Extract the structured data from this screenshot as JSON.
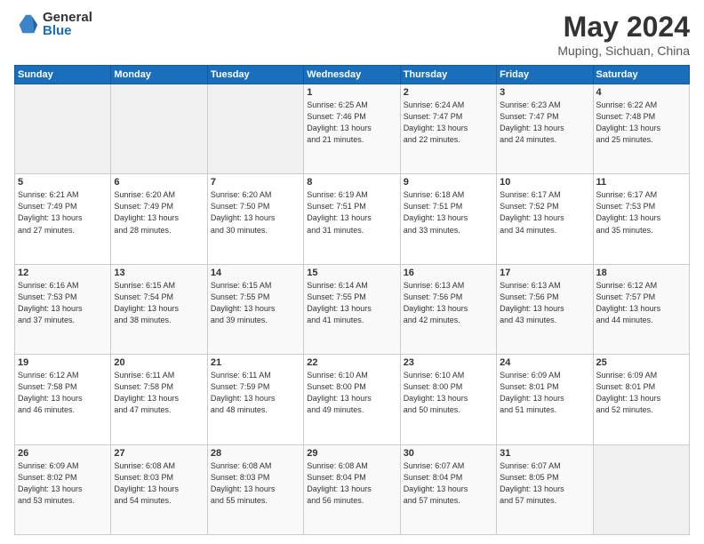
{
  "header": {
    "logo_general": "General",
    "logo_blue": "Blue",
    "title": "May 2024",
    "subtitle": "Muping, Sichuan, China"
  },
  "days_of_week": [
    "Sunday",
    "Monday",
    "Tuesday",
    "Wednesday",
    "Thursday",
    "Friday",
    "Saturday"
  ],
  "weeks": [
    {
      "days": [
        {
          "num": "",
          "info": ""
        },
        {
          "num": "",
          "info": ""
        },
        {
          "num": "",
          "info": ""
        },
        {
          "num": "1",
          "info": "Sunrise: 6:25 AM\nSunset: 7:46 PM\nDaylight: 13 hours\nand 21 minutes."
        },
        {
          "num": "2",
          "info": "Sunrise: 6:24 AM\nSunset: 7:47 PM\nDaylight: 13 hours\nand 22 minutes."
        },
        {
          "num": "3",
          "info": "Sunrise: 6:23 AM\nSunset: 7:47 PM\nDaylight: 13 hours\nand 24 minutes."
        },
        {
          "num": "4",
          "info": "Sunrise: 6:22 AM\nSunset: 7:48 PM\nDaylight: 13 hours\nand 25 minutes."
        }
      ]
    },
    {
      "days": [
        {
          "num": "5",
          "info": "Sunrise: 6:21 AM\nSunset: 7:49 PM\nDaylight: 13 hours\nand 27 minutes."
        },
        {
          "num": "6",
          "info": "Sunrise: 6:20 AM\nSunset: 7:49 PM\nDaylight: 13 hours\nand 28 minutes."
        },
        {
          "num": "7",
          "info": "Sunrise: 6:20 AM\nSunset: 7:50 PM\nDaylight: 13 hours\nand 30 minutes."
        },
        {
          "num": "8",
          "info": "Sunrise: 6:19 AM\nSunset: 7:51 PM\nDaylight: 13 hours\nand 31 minutes."
        },
        {
          "num": "9",
          "info": "Sunrise: 6:18 AM\nSunset: 7:51 PM\nDaylight: 13 hours\nand 33 minutes."
        },
        {
          "num": "10",
          "info": "Sunrise: 6:17 AM\nSunset: 7:52 PM\nDaylight: 13 hours\nand 34 minutes."
        },
        {
          "num": "11",
          "info": "Sunrise: 6:17 AM\nSunset: 7:53 PM\nDaylight: 13 hours\nand 35 minutes."
        }
      ]
    },
    {
      "days": [
        {
          "num": "12",
          "info": "Sunrise: 6:16 AM\nSunset: 7:53 PM\nDaylight: 13 hours\nand 37 minutes."
        },
        {
          "num": "13",
          "info": "Sunrise: 6:15 AM\nSunset: 7:54 PM\nDaylight: 13 hours\nand 38 minutes."
        },
        {
          "num": "14",
          "info": "Sunrise: 6:15 AM\nSunset: 7:55 PM\nDaylight: 13 hours\nand 39 minutes."
        },
        {
          "num": "15",
          "info": "Sunrise: 6:14 AM\nSunset: 7:55 PM\nDaylight: 13 hours\nand 41 minutes."
        },
        {
          "num": "16",
          "info": "Sunrise: 6:13 AM\nSunset: 7:56 PM\nDaylight: 13 hours\nand 42 minutes."
        },
        {
          "num": "17",
          "info": "Sunrise: 6:13 AM\nSunset: 7:56 PM\nDaylight: 13 hours\nand 43 minutes."
        },
        {
          "num": "18",
          "info": "Sunrise: 6:12 AM\nSunset: 7:57 PM\nDaylight: 13 hours\nand 44 minutes."
        }
      ]
    },
    {
      "days": [
        {
          "num": "19",
          "info": "Sunrise: 6:12 AM\nSunset: 7:58 PM\nDaylight: 13 hours\nand 46 minutes."
        },
        {
          "num": "20",
          "info": "Sunrise: 6:11 AM\nSunset: 7:58 PM\nDaylight: 13 hours\nand 47 minutes."
        },
        {
          "num": "21",
          "info": "Sunrise: 6:11 AM\nSunset: 7:59 PM\nDaylight: 13 hours\nand 48 minutes."
        },
        {
          "num": "22",
          "info": "Sunrise: 6:10 AM\nSunset: 8:00 PM\nDaylight: 13 hours\nand 49 minutes."
        },
        {
          "num": "23",
          "info": "Sunrise: 6:10 AM\nSunset: 8:00 PM\nDaylight: 13 hours\nand 50 minutes."
        },
        {
          "num": "24",
          "info": "Sunrise: 6:09 AM\nSunset: 8:01 PM\nDaylight: 13 hours\nand 51 minutes."
        },
        {
          "num": "25",
          "info": "Sunrise: 6:09 AM\nSunset: 8:01 PM\nDaylight: 13 hours\nand 52 minutes."
        }
      ]
    },
    {
      "days": [
        {
          "num": "26",
          "info": "Sunrise: 6:09 AM\nSunset: 8:02 PM\nDaylight: 13 hours\nand 53 minutes."
        },
        {
          "num": "27",
          "info": "Sunrise: 6:08 AM\nSunset: 8:03 PM\nDaylight: 13 hours\nand 54 minutes."
        },
        {
          "num": "28",
          "info": "Sunrise: 6:08 AM\nSunset: 8:03 PM\nDaylight: 13 hours\nand 55 minutes."
        },
        {
          "num": "29",
          "info": "Sunrise: 6:08 AM\nSunset: 8:04 PM\nDaylight: 13 hours\nand 56 minutes."
        },
        {
          "num": "30",
          "info": "Sunrise: 6:07 AM\nSunset: 8:04 PM\nDaylight: 13 hours\nand 57 minutes."
        },
        {
          "num": "31",
          "info": "Sunrise: 6:07 AM\nSunset: 8:05 PM\nDaylight: 13 hours\nand 57 minutes."
        },
        {
          "num": "",
          "info": ""
        }
      ]
    }
  ]
}
